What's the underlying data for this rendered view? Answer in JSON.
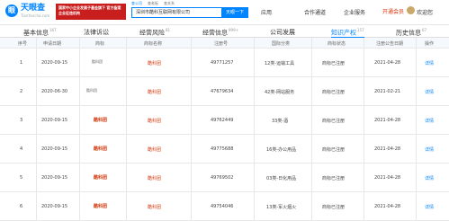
{
  "header": {
    "logo_cn": "天眼查",
    "logo_en": "TianYancha.com",
    "promo": "国家中小企业发展子基金旗下 官方备案企业征信机构",
    "search_tabs": [
      "查公司",
      "查老板",
      "查关系"
    ],
    "search_value": "深圳市酷科互联网有限公司",
    "search_button": "天眼一下",
    "nav": [
      "应用",
      "合作通道",
      "企业服务",
      "开通会员"
    ],
    "user_name": "欢迎您"
  },
  "tabs": [
    {
      "label": "基本信息",
      "count": "167"
    },
    {
      "label": "法律诉讼",
      "count": ""
    },
    {
      "label": "经营风险",
      "count": "81"
    },
    {
      "label": "经营信息",
      "count": "999+"
    },
    {
      "label": "公司发展",
      "count": ""
    },
    {
      "label": "知识产权",
      "count": "157"
    },
    {
      "label": "历史信息",
      "count": "67"
    }
  ],
  "table": {
    "columns": [
      "序号",
      "申请日期",
      "商标",
      "商标名称",
      "注册号",
      "国际分类",
      "商标状态",
      "注册公告日期",
      "操作"
    ],
    "rows": [
      {
        "no": "1",
        "date": "2020-09-15",
        "logo": "酷科团",
        "name": "酷科团",
        "reg": "49771257",
        "cls": "12类-运输工具",
        "status": "商标已注册",
        "pub": "2021-04-28",
        "op": "详情"
      },
      {
        "no": "2",
        "date": "2020-06-30",
        "logo": "酷科团",
        "name": "酷科团",
        "reg": "47679634",
        "cls": "42类-网站服务",
        "status": "商标已注册",
        "pub": "2021-02-21",
        "op": "详情"
      },
      {
        "no": "3",
        "date": "2020-09-15",
        "logo": "酷科团",
        "name": "酷科团",
        "reg": "49762449",
        "cls": "33类-酒",
        "status": "商标已注册",
        "pub": "2021-04-28",
        "op": "详情"
      },
      {
        "no": "4",
        "date": "2020-09-15",
        "logo": "酷科团",
        "name": "酷科团",
        "reg": "49775688",
        "cls": "16类-办公用品",
        "status": "商标已注册",
        "pub": "2021-04-28",
        "op": "详情"
      },
      {
        "no": "5",
        "date": "2020-09-15",
        "logo": "酷科团",
        "name": "酷科团",
        "reg": "49769502",
        "cls": "03类-日化用品",
        "status": "商标已注册",
        "pub": "2021-04-28",
        "op": "详情"
      },
      {
        "no": "6",
        "date": "2020-09-15",
        "logo": "酷科团",
        "name": "酷科团",
        "reg": "49754046",
        "cls": "13类-军火烟火",
        "status": "商标已注册",
        "pub": "2021-04-28",
        "op": "详情"
      }
    ]
  }
}
